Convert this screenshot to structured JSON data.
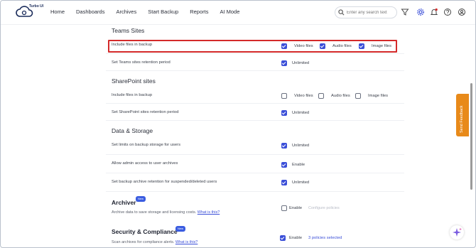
{
  "brand": {
    "name": "Turbo UI"
  },
  "nav": {
    "items": [
      "Home",
      "Dashboards",
      "Archives",
      "Start Backup",
      "Reports",
      "AI Mode"
    ]
  },
  "search": {
    "placeholder": "Enter any search text"
  },
  "colors": {
    "accent": "#3b4fd8",
    "highlight": "#d42a2a",
    "feedback": "#e88a1a",
    "badge": "#3a5ce0"
  },
  "teams": {
    "title": "Teams Sites",
    "include": {
      "label": "Include files in backup",
      "options": [
        {
          "label": "Video files",
          "checked": true
        },
        {
          "label": "Audio files",
          "checked": true
        },
        {
          "label": "Image files",
          "checked": true
        }
      ]
    },
    "retention": {
      "label": "Set Teams sites retention period",
      "value": "Unlimited",
      "checked": true
    }
  },
  "sharepoint": {
    "title": "SharePoint sites",
    "include": {
      "label": "Include files in backup",
      "options": [
        {
          "label": "Video files",
          "checked": false
        },
        {
          "label": "Audio files",
          "checked": false
        },
        {
          "label": "Image files",
          "checked": false
        }
      ]
    },
    "retention": {
      "label": "Set SharePoint sites retention period",
      "value": "Unlimited",
      "checked": true
    }
  },
  "storage": {
    "title": "Data & Storage",
    "rows": [
      {
        "label": "Set limits on backup storage for users",
        "value": "Unlimited",
        "checked": true
      },
      {
        "label": "Allow admin access to user archives",
        "value": "Enable",
        "checked": true
      },
      {
        "label": "Set backup archive retention for suspended/deleted users",
        "value": "Unlimited",
        "checked": true
      }
    ]
  },
  "archiver": {
    "title": "Archiver",
    "badge": "New",
    "desc": "Archive data to save storage and licensing costs.",
    "link": "What is this?",
    "toggle": "Enable",
    "toggle_checked": false,
    "action": "Configure policies"
  },
  "security": {
    "title": "Security & Compliance",
    "badge": "New",
    "desc": "Scan archives for compliance alerts.",
    "link": "What is this?",
    "toggle": "Enable",
    "toggle_checked": true,
    "action": "3 policies selected"
  },
  "feedback": {
    "label": "Send Feedback"
  }
}
